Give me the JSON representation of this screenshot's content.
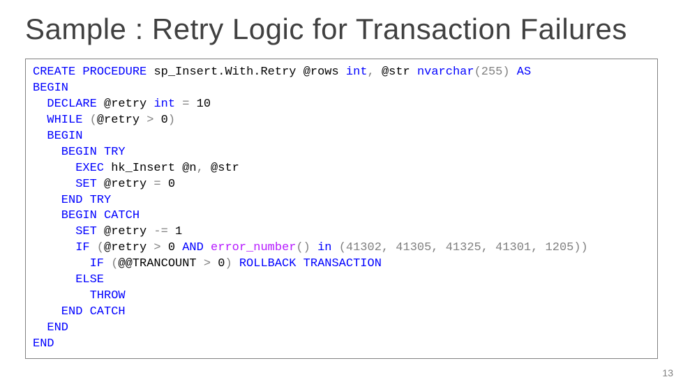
{
  "title": "Sample : Retry Logic for Transaction Failures",
  "page_number": "13",
  "code": {
    "l1": {
      "kw1": "CREATE",
      "kw2": "PROCEDURE",
      "proc": "sp_Insert.With.Retry",
      "p1": "@rows",
      "t1": "int",
      "c1": ",",
      "p2": "@str",
      "t2": "nvarchar",
      "paren": "(255)",
      "as": "AS"
    },
    "l2": {
      "kw": "BEGIN"
    },
    "l3": {
      "kw": "DECLARE",
      "var": "@retry",
      "type": "int",
      "eq": "=",
      "val": "10"
    },
    "l4": {
      "kw": "WHILE",
      "open": "(",
      "var": "@retry",
      "op": ">",
      "val": "0",
      "close": ")"
    },
    "l5": {
      "kw": "BEGIN"
    },
    "l6": {
      "kw1": "BEGIN",
      "kw2": "TRY"
    },
    "l7": {
      "kw": "EXEC",
      "proc": "hk_Insert",
      "p1": "@n",
      "c": ",",
      "p2": "@str"
    },
    "l8": {
      "kw": "SET",
      "var": "@retry",
      "eq": "=",
      "val": "0"
    },
    "l9": {
      "kw1": "END",
      "kw2": "TRY"
    },
    "l10": {
      "kw1": "BEGIN",
      "kw2": "CATCH"
    },
    "l11": {
      "kw": "SET",
      "var": "@retry",
      "op": "-=",
      "val": "1"
    },
    "l12": {
      "kw1": "IF",
      "open": "(",
      "var": "@retry",
      "gt": ">",
      "zero": "0",
      "and": "AND",
      "fn": "error_number",
      "call": "()",
      "in": "in",
      "list": "(41302, 41305, 41325, 41301, 1205))"
    },
    "l13": {
      "kw1": "IF",
      "open": "(",
      "var": "@@TRANCOUNT",
      "gt": ">",
      "zero": "0",
      "close": ")",
      "kw2": "ROLLBACK",
      "kw3": "TRANSACTION"
    },
    "l14": {
      "kw": "ELSE"
    },
    "l15": {
      "kw": "THROW"
    },
    "l16": {
      "kw1": "END",
      "kw2": "CATCH"
    },
    "l17": {
      "kw": "END"
    },
    "l18": {
      "kw": "END"
    }
  }
}
